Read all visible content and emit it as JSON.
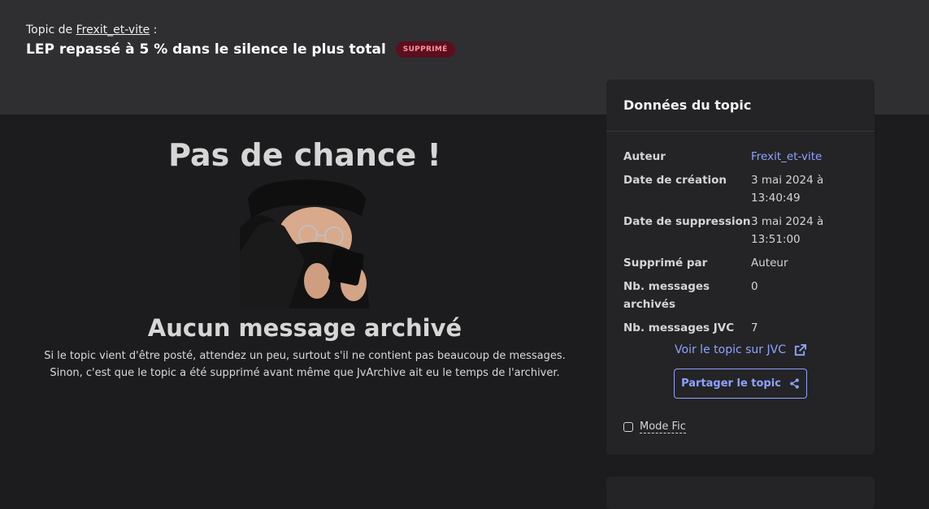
{
  "header": {
    "crumb_prefix": "Topic de",
    "author": "Frexit_et-vite",
    "crumb_suffix": ":",
    "title": "LEP repassé à 5 % dans le silence le plus total",
    "badge": "SUPPRIMÉ"
  },
  "main": {
    "heading": "Pas de chance !",
    "subheading": "Aucun message archivé",
    "help_line1": "Si le topic vient d'être posté, attendez un peu, surtout s'il ne contient pas beaucoup de messages.",
    "help_line2": "Sinon, c'est que le topic a été supprimé avant même que JvArchive ait eu le temps de l'archiver."
  },
  "sidebar": {
    "title": "Données du topic",
    "rows": [
      {
        "label": "Auteur",
        "value": "Frexit_et-vite"
      },
      {
        "label": "Date de création",
        "value": "3 mai 2024 à 13:40:49"
      },
      {
        "label": "Date de suppression",
        "value": "3 mai 2024 à 13:51:00"
      },
      {
        "label": "Supprimé par",
        "value": "Auteur"
      },
      {
        "label": "Nb. messages archivés",
        "value": "0"
      },
      {
        "label": "Nb. messages JVC",
        "value": "7"
      }
    ],
    "jvc_link": "Voir le topic sur JVC",
    "share_label": "Partager le topic",
    "mode_fic": "Mode Fic"
  },
  "colors": {
    "accent": "#8ea2ff",
    "badge_bg": "#5a0f1c",
    "badge_text": "#ff8fa0"
  }
}
